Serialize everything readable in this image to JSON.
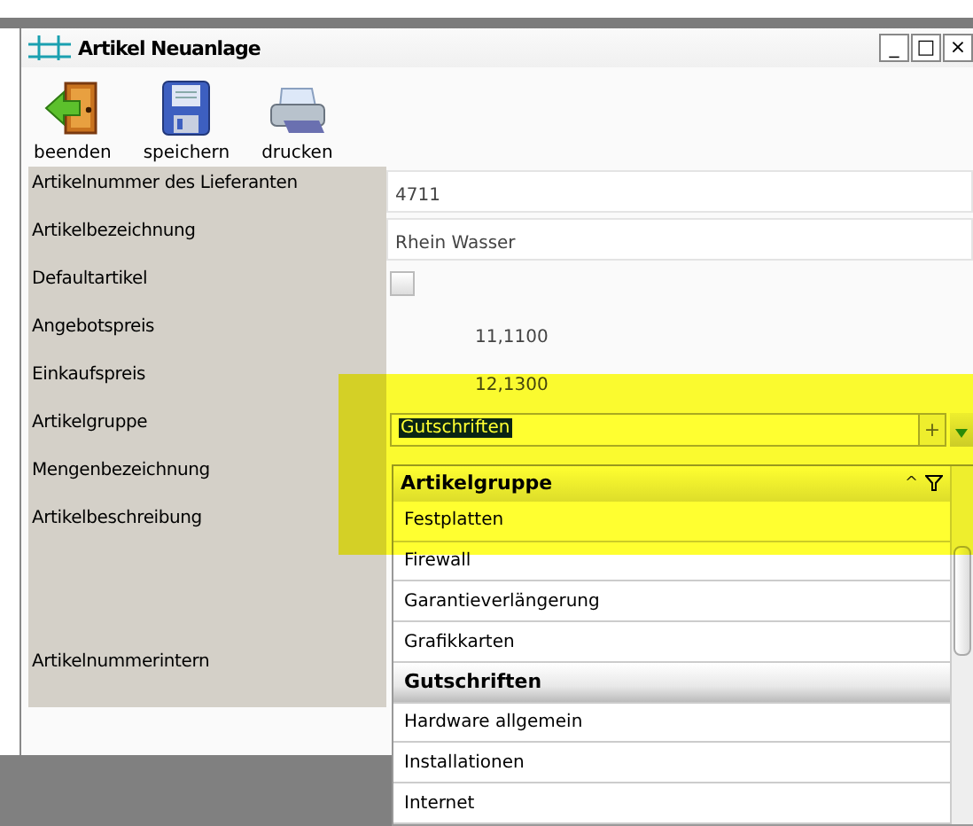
{
  "window": {
    "title": "Artikel Neuanlage",
    "controls": [
      "_",
      "□",
      "×"
    ]
  },
  "toolbar": [
    {
      "label": "beenden",
      "kind": "exit"
    },
    {
      "label": "speichern",
      "kind": "save"
    },
    {
      "label": "drucken",
      "kind": "print"
    }
  ],
  "fields": [
    {
      "label": "Artikelnummer des Lieferanten",
      "kind": "text",
      "value": "4711"
    },
    {
      "label": "Artikelbezeichnung",
      "kind": "text",
      "value": "Rhein Wasser"
    },
    {
      "label": "Defaultartikel",
      "kind": "checkbox",
      "checked": false
    },
    {
      "label": "Angebotspreis",
      "kind": "number",
      "value": "11,1100"
    },
    {
      "label": "Einkaufspreis",
      "kind": "number",
      "value": "12,1300"
    },
    {
      "label": "Artikelgruppe",
      "kind": "combo",
      "value": "Gutschriften",
      "add": "+"
    },
    {
      "label": "Mengenbezeichnung",
      "kind": "empty"
    },
    {
      "label": "Artikelbeschreibung",
      "kind": "tall"
    },
    {
      "label": "Artikelnummerintern",
      "kind": "empty"
    }
  ],
  "dropdown": {
    "header": "Artikelgruppe",
    "sort": "^",
    "items": [
      {
        "label": "Festplatten",
        "selected": false
      },
      {
        "label": "Firewall",
        "selected": false
      },
      {
        "label": "Garantieverlängerung",
        "selected": false
      },
      {
        "label": "Grafikkarten",
        "selected": false
      },
      {
        "label": "Gutschriften",
        "selected": true
      },
      {
        "label": "Hardware allgemein",
        "selected": false
      },
      {
        "label": "Installationen",
        "selected": false
      },
      {
        "label": "Internet",
        "selected": false
      }
    ]
  }
}
